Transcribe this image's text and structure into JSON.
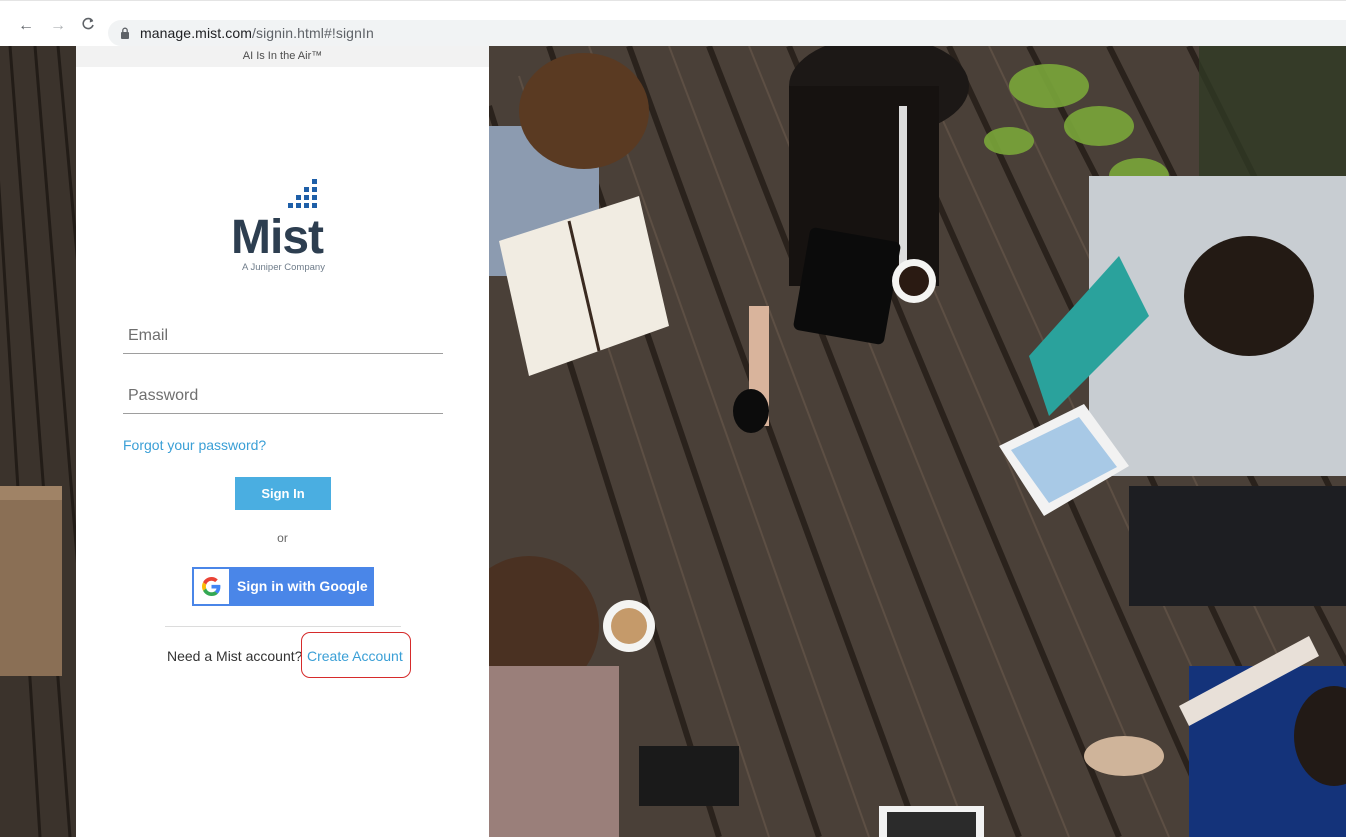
{
  "browser": {
    "url_host": "manage.mist.com",
    "url_path": "/signin.html#!signIn",
    "back_icon": "arrow-left-icon",
    "forward_icon": "arrow-right-icon",
    "reload_icon": "reload-icon",
    "lock_icon": "lock-icon"
  },
  "panel": {
    "tagline": "AI Is In the Air™",
    "logo_word": "Mist",
    "logo_sub": "A Juniper Company"
  },
  "form": {
    "email_placeholder": "Email",
    "email_value": "",
    "password_placeholder": "Password",
    "password_value": "",
    "forgot_label": "Forgot your password?",
    "signin_label": "Sign In",
    "or_label": "or",
    "google_label": "Sign in with Google",
    "need_account": "Need a Mist account?",
    "create_account": "Create Account"
  },
  "colors": {
    "accent": "#4aaee1",
    "google_blue": "#4a86e8",
    "link": "#3a9fd6",
    "logo_navy": "#2d3e50",
    "highlight_red": "#d62b2b"
  }
}
